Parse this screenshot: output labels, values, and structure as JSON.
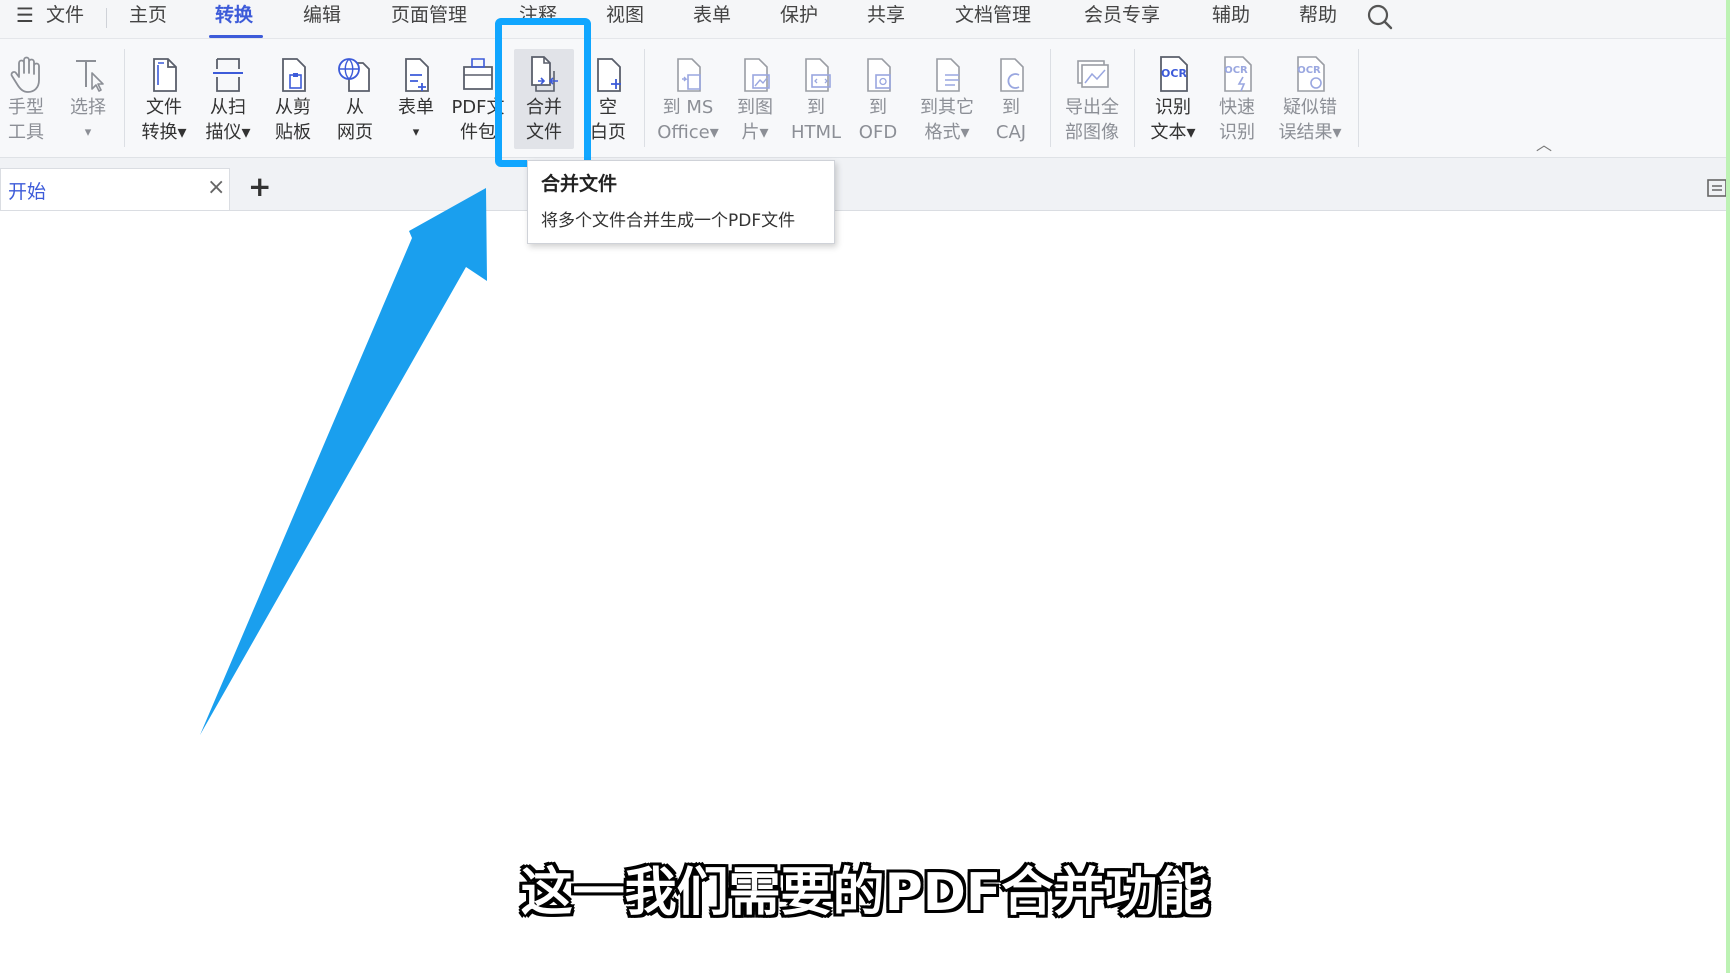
{
  "menubar": {
    "menu_icon": "☰",
    "items": [
      "文件",
      "主页",
      "转换",
      "编辑",
      "页面管理",
      "注释",
      "视图",
      "表单",
      "保护",
      "共享",
      "文档管理",
      "会员专享",
      "辅助",
      "帮助"
    ],
    "active": "转换"
  },
  "ribbon": {
    "buttons": [
      {
        "line1": "手型",
        "line2": "工具",
        "icon": "hand-icon"
      },
      {
        "line1": "选择",
        "line2": "▾",
        "icon": "text-select-icon"
      },
      {
        "line1": "文件",
        "line2": "转换▾",
        "icon": "file-convert-icon"
      },
      {
        "line1": "从扫",
        "line2": "描仪▾",
        "icon": "scanner-icon"
      },
      {
        "line1": "从剪",
        "line2": "贴板",
        "icon": "clipboard-icon"
      },
      {
        "line1": "从",
        "line2": "网页",
        "icon": "web-page-icon"
      },
      {
        "line1": "表单",
        "line2": "▾",
        "icon": "form-icon"
      },
      {
        "line1": "PDF文",
        "line2": "件包",
        "icon": "pdf-package-icon"
      },
      {
        "line1": "合并",
        "line2": "文件",
        "icon": "merge-files-icon"
      },
      {
        "line1": "空",
        "line2": "白页",
        "icon": "blank-page-icon"
      },
      {
        "line1": "到 MS",
        "line2": "Office▾",
        "icon": "to-office-icon"
      },
      {
        "line1": "到图",
        "line2": "片▾",
        "icon": "to-image-icon"
      },
      {
        "line1": "到",
        "line2": "HTML",
        "icon": "to-html-icon"
      },
      {
        "line1": "到",
        "line2": "OFD",
        "icon": "to-ofd-icon"
      },
      {
        "line1": "到其它",
        "line2": "格式▾",
        "icon": "to-other-format-icon"
      },
      {
        "line1": "到",
        "line2": "CAJ",
        "icon": "to-caj-icon"
      },
      {
        "line1": "导出全",
        "line2": "部图像",
        "icon": "export-images-icon"
      },
      {
        "line1": "识别",
        "line2": "文本▾",
        "icon": "ocr-icon",
        "ocr": "OCR"
      },
      {
        "line1": "快速",
        "line2": "识别",
        "icon": "quick-ocr-icon",
        "ocr": "OCR"
      },
      {
        "line1": "疑似错",
        "line2": "误结果▾",
        "icon": "suspect-ocr-icon",
        "ocr": "OCR"
      }
    ],
    "collapse_icon": "︿"
  },
  "tabs": {
    "start_label": "开始",
    "close": "×",
    "add": "+"
  },
  "tooltip": {
    "title": "合并文件",
    "description": "将多个文件合并生成一个PDF文件"
  },
  "subtitle": "这一我们需要的PDF合并功能",
  "colors": {
    "accent": "#3d5bd9",
    "highlight": "#10a6ff",
    "icon_stroke": "#5a5f6b"
  }
}
